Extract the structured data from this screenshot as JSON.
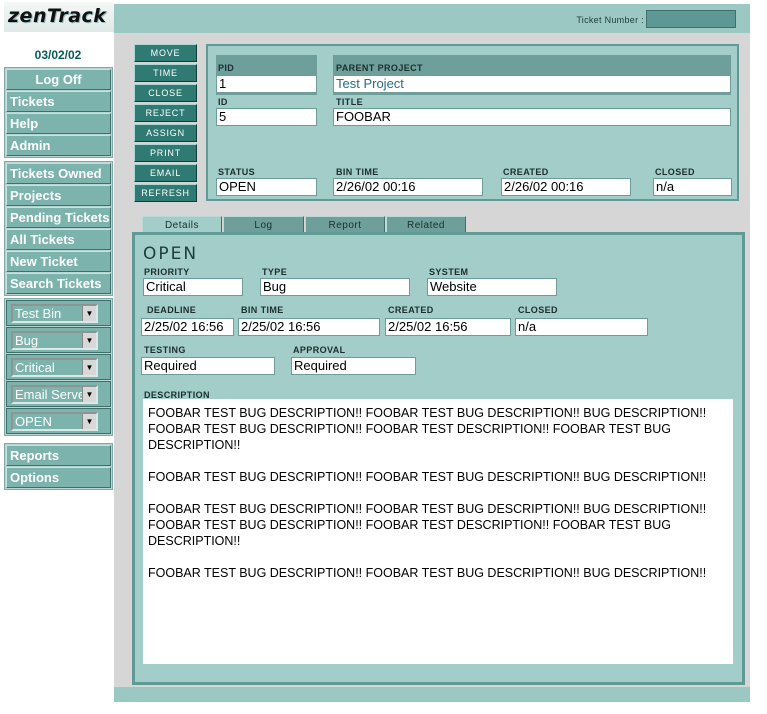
{
  "app": {
    "logo": "zenTrack",
    "date": "03/02/02"
  },
  "nav": {
    "top": [
      "Log Off",
      "Tickets",
      "Help",
      "Admin"
    ],
    "views": [
      "Tickets Owned",
      "Projects",
      "Pending Tickets",
      "All Tickets",
      "New Ticket",
      "Search Tickets"
    ],
    "selects": [
      "Test Bin",
      "Bug",
      "Critical",
      "Email Server",
      "OPEN"
    ],
    "bottom": [
      "Reports",
      "Options"
    ]
  },
  "header": {
    "ticket_number_label": "Ticket Number :",
    "ticket_number_value": ""
  },
  "actions": [
    "MOVE",
    "TIME",
    "CLOSE",
    "REJECT",
    "ASSIGN",
    "PRINT",
    "EMAIL",
    "REFRESH"
  ],
  "ticket": {
    "pid_label": "PID",
    "pid": "1",
    "parent_project_label": "PARENT PROJECT",
    "parent_project": "Test Project",
    "id_label": "ID",
    "id": "5",
    "title_label": "TITLE",
    "title": "FOOBAR",
    "status_label": "STATUS",
    "status": "OPEN",
    "bin_time_label": "BIN TIME",
    "bin_time": "2/26/02 00:16",
    "created_label": "CREATED",
    "created": "2/26/02 00:16",
    "closed_label": "CLOSED",
    "closed": "n/a"
  },
  "tabs": [
    "Details",
    "Log",
    "Report",
    "Related"
  ],
  "details": {
    "status_heading": "OPEN",
    "priority_label": "PRIORITY",
    "priority": "Critical",
    "type_label": "TYPE",
    "type": "Bug",
    "system_label": "SYSTEM",
    "system": "Website",
    "deadline_label": "DEADLINE",
    "deadline": "2/25/02 16:56",
    "bin_time_label": "BIN TIME",
    "bin_time": "2/25/02 16:56",
    "created_label": "CREATED",
    "created": "2/25/02 16:56",
    "closed_label": "CLOSED",
    "closed": "n/a",
    "testing_label": "TESTING",
    "testing": "Required",
    "approval_label": "APPROVAL",
    "approval": "Required",
    "description_label": "DESCRIPTION",
    "description_paragraphs": [
      "FOOBAR TEST BUG DESCRIPTION!! FOOBAR TEST BUG DESCRIPTION!! BUG DESCRIPTION!! FOOBAR TEST BUG DESCRIPTION!! FOOBAR TEST DESCRIPTION!! FOOBAR TEST BUG DESCRIPTION!!",
      "FOOBAR TEST BUG DESCRIPTION!! FOOBAR TEST BUG DESCRIPTION!! BUG DESCRIPTION!!",
      "FOOBAR TEST BUG DESCRIPTION!! FOOBAR TEST BUG DESCRIPTION!! BUG DESCRIPTION!! FOOBAR TEST BUG DESCRIPTION!! FOOBAR TEST DESCRIPTION!! FOOBAR TEST BUG DESCRIPTION!!",
      "FOOBAR TEST BUG DESCRIPTION!! FOOBAR TEST BUG DESCRIPTION!! BUG DESCRIPTION!!"
    ]
  }
}
